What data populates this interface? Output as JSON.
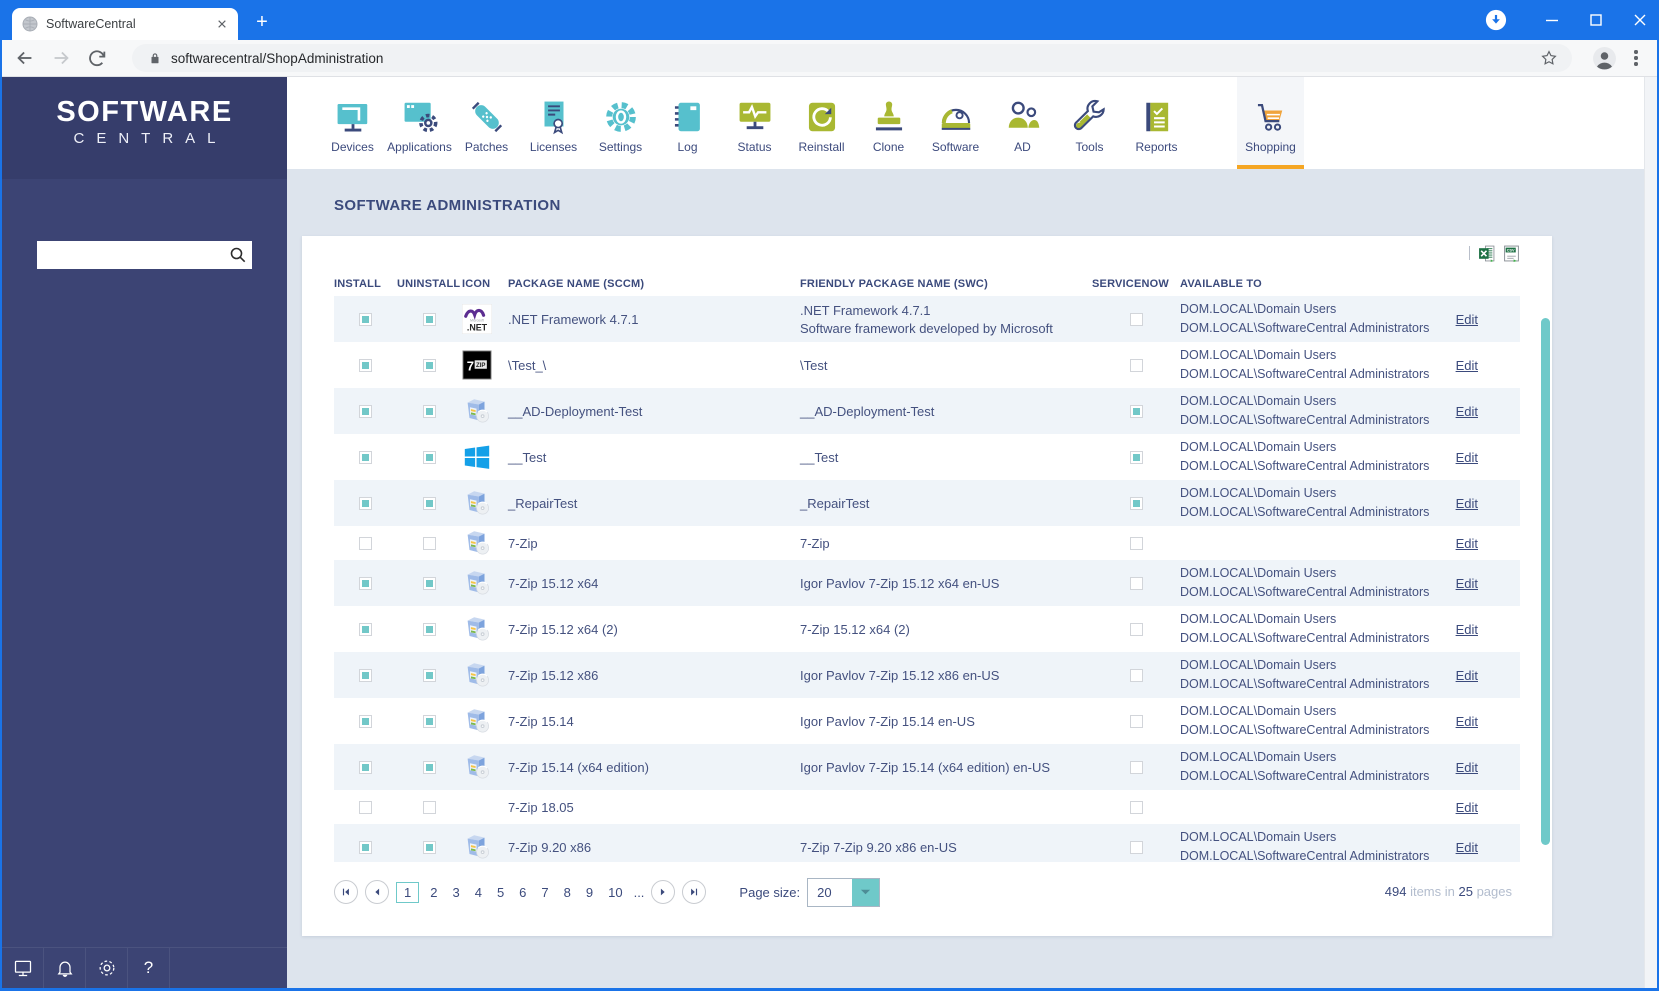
{
  "colors": {
    "titlebar_blue": "#1a73e8",
    "sidebar_navy": "#3c4474",
    "accent_orange": "#f5a623",
    "icon_teal": "#56c0cd",
    "icon_olive": "#a9b832",
    "icon_navy": "#3b4a7c",
    "checkbox_teal": "#72c8c8"
  },
  "browser": {
    "tab_title": "SoftwareCentral",
    "new_tab_label": "+",
    "url": "softwarecentral/ShopAdministration",
    "favicon": "globe-icon",
    "window_controls": [
      "minimize",
      "maximize",
      "close"
    ]
  },
  "sidebar": {
    "logo_line1": "SOFTWARE",
    "logo_line2": "CENTRAL",
    "search_value": "",
    "footer_icons": [
      {
        "name": "computer-icon",
        "glyph": "monitor"
      },
      {
        "name": "notifications-icon",
        "glyph": "bell"
      },
      {
        "name": "settings-gear-icon",
        "glyph": "gear"
      },
      {
        "name": "help-icon",
        "glyph": "help"
      }
    ]
  },
  "nav": {
    "items": [
      {
        "label": "Devices",
        "icon": "devices"
      },
      {
        "label": "Applications",
        "icon": "applications"
      },
      {
        "label": "Patches",
        "icon": "patches"
      },
      {
        "label": "Licenses",
        "icon": "licenses"
      },
      {
        "label": "Settings",
        "icon": "settings"
      },
      {
        "label": "Log",
        "icon": "log"
      },
      {
        "label": "Status",
        "icon": "status"
      },
      {
        "label": "Reinstall",
        "icon": "reinstall"
      },
      {
        "label": "Clone",
        "icon": "clone"
      },
      {
        "label": "Software",
        "icon": "software"
      },
      {
        "label": "AD",
        "icon": "ad"
      },
      {
        "label": "Tools",
        "icon": "tools"
      },
      {
        "label": "Reports",
        "icon": "reports"
      },
      {
        "label": "Shopping",
        "icon": "shopping",
        "active": true,
        "offset": true
      }
    ]
  },
  "page": {
    "title": "SOFTWARE ADMINISTRATION"
  },
  "export": {
    "separator": "|",
    "icons": [
      "excel-export-icon",
      "csv-export-icon"
    ]
  },
  "table": {
    "columns": [
      "INSTALL",
      "UNINSTALL",
      "ICON",
      "PACKAGE NAME (SCCM)",
      "FRIENDLY PACKAGE NAME (SWC)",
      "SERVICENOW",
      "AVAILABLE TO"
    ],
    "edit_label": "Edit",
    "rows": [
      {
        "size": "tall",
        "install": true,
        "uninstall": true,
        "servicenow": false,
        "icon": "dotnet",
        "package": ".NET Framework 4.7.1",
        "friendly": [
          ".NET Framework 4.7.1",
          "Software framework developed by Microsoft"
        ],
        "available": [
          "DOM.LOCAL\\Domain Users",
          "DOM.LOCAL\\SoftwareCentral Administrators"
        ]
      },
      {
        "size": "tall",
        "install": true,
        "uninstall": true,
        "servicenow": false,
        "icon": "sevenzip",
        "package": "\\Test_\\",
        "friendly": [
          "\\Test"
        ],
        "available": [
          "DOM.LOCAL\\Domain Users",
          "DOM.LOCAL\\SoftwareCentral Administrators"
        ]
      },
      {
        "size": "tall",
        "install": true,
        "uninstall": true,
        "servicenow": true,
        "icon": "installer",
        "package": "__AD-Deployment-Test",
        "friendly": [
          "__AD-Deployment-Test"
        ],
        "available": [
          "DOM.LOCAL\\Domain Users",
          "DOM.LOCAL\\SoftwareCentral Administrators"
        ]
      },
      {
        "size": "tall",
        "install": true,
        "uninstall": true,
        "servicenow": true,
        "icon": "windows",
        "package": "__Test",
        "friendly": [
          "__Test"
        ],
        "available": [
          "DOM.LOCAL\\Domain Users",
          "DOM.LOCAL\\SoftwareCentral Administrators"
        ]
      },
      {
        "size": "tall",
        "install": true,
        "uninstall": true,
        "servicenow": true,
        "icon": "installer",
        "package": "_RepairTest",
        "friendly": [
          "_RepairTest"
        ],
        "available": [
          "DOM.LOCAL\\Domain Users",
          "DOM.LOCAL\\SoftwareCentral Administrators"
        ]
      },
      {
        "size": "short",
        "install": false,
        "uninstall": false,
        "servicenow": false,
        "icon": "installer",
        "package": "7-Zip",
        "friendly": [
          "7-Zip"
        ],
        "available": []
      },
      {
        "size": "tall",
        "install": true,
        "uninstall": true,
        "servicenow": false,
        "icon": "installer",
        "package": "7-Zip 15.12 x64",
        "friendly": [
          "Igor Pavlov 7-Zip 15.12 x64 en-US"
        ],
        "available": [
          "DOM.LOCAL\\Domain Users",
          "DOM.LOCAL\\SoftwareCentral Administrators"
        ]
      },
      {
        "size": "tall",
        "install": true,
        "uninstall": true,
        "servicenow": false,
        "icon": "installer",
        "package": "7-Zip 15.12 x64 (2)",
        "friendly": [
          "7-Zip 15.12 x64 (2)"
        ],
        "available": [
          "DOM.LOCAL\\Domain Users",
          "DOM.LOCAL\\SoftwareCentral Administrators"
        ]
      },
      {
        "size": "tall",
        "install": true,
        "uninstall": true,
        "servicenow": false,
        "icon": "installer",
        "package": "7-Zip 15.12 x86",
        "friendly": [
          "Igor Pavlov 7-Zip 15.12 x86 en-US"
        ],
        "available": [
          "DOM.LOCAL\\Domain Users",
          "DOM.LOCAL\\SoftwareCentral Administrators"
        ]
      },
      {
        "size": "tall",
        "install": true,
        "uninstall": true,
        "servicenow": false,
        "icon": "installer",
        "package": "7-Zip 15.14",
        "friendly": [
          "Igor Pavlov 7-Zip 15.14 en-US"
        ],
        "available": [
          "DOM.LOCAL\\Domain Users",
          "DOM.LOCAL\\SoftwareCentral Administrators"
        ]
      },
      {
        "size": "tall",
        "install": true,
        "uninstall": true,
        "servicenow": false,
        "icon": "installer",
        "package": "7-Zip 15.14 (x64 edition)",
        "friendly": [
          "Igor Pavlov 7-Zip 15.14 (x64 edition) en-US"
        ],
        "available": [
          "DOM.LOCAL\\Domain Users",
          "DOM.LOCAL\\SoftwareCentral Administrators"
        ]
      },
      {
        "size": "short",
        "install": false,
        "uninstall": false,
        "servicenow": false,
        "icon": "none",
        "package": "7-Zip 18.05",
        "friendly": [],
        "available": []
      },
      {
        "size": "tall",
        "install": true,
        "uninstall": true,
        "servicenow": false,
        "icon": "installer",
        "package": "7-Zip 9.20 x86",
        "friendly": [
          "7-Zip 7-Zip 9.20 x86 en-US"
        ],
        "available": [
          "DOM.LOCAL\\Domain Users",
          "DOM.LOCAL\\SoftwareCentral Administrators"
        ]
      }
    ]
  },
  "pagination": {
    "buttons": [
      "first",
      "previous",
      "next",
      "last"
    ],
    "pages": [
      "1",
      "2",
      "3",
      "4",
      "5",
      "6",
      "7",
      "8",
      "9",
      "10"
    ],
    "current": "1",
    "ellipsis": "...",
    "page_size_label": "Page size:",
    "page_size": "20",
    "summary": {
      "count": "494",
      "items_label": "items in",
      "page_count": "25",
      "pages_label": "pages"
    }
  }
}
